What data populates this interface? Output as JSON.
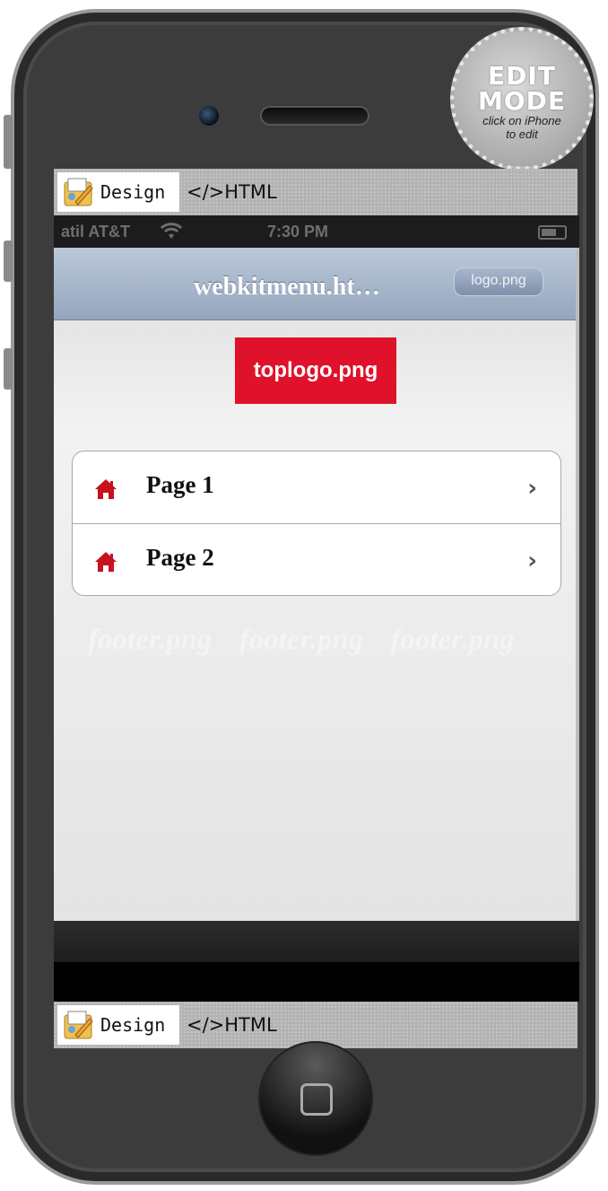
{
  "edit_sticker": {
    "line1": "EDIT",
    "line2": "MODE",
    "line3": "click on iPhone",
    "line4": "to edit"
  },
  "top_toolbar": {
    "design_label": "Design",
    "html_label": "</>HTML"
  },
  "status_bar": {
    "carrier": "atil AT&T",
    "time": "7:30 PM"
  },
  "nav_bar": {
    "title": "webkitmenu.ht…",
    "logo_label": "logo.png"
  },
  "content": {
    "top_logo": "toplogo.png",
    "menu": [
      {
        "label": "Page 1",
        "icon": "home-icon",
        "chevron": "›"
      },
      {
        "label": "Page 2",
        "icon": "home-icon",
        "chevron": "›"
      }
    ],
    "footer_images": [
      "footer.png",
      "footer.png",
      "footer.png"
    ]
  },
  "bottom_toolbar": {
    "design_label": "Design",
    "html_label": "</>HTML"
  },
  "colors": {
    "logo_red": "#e0112a",
    "nav_blue": "#94a6be",
    "home_icon_red": "#c8101e"
  }
}
